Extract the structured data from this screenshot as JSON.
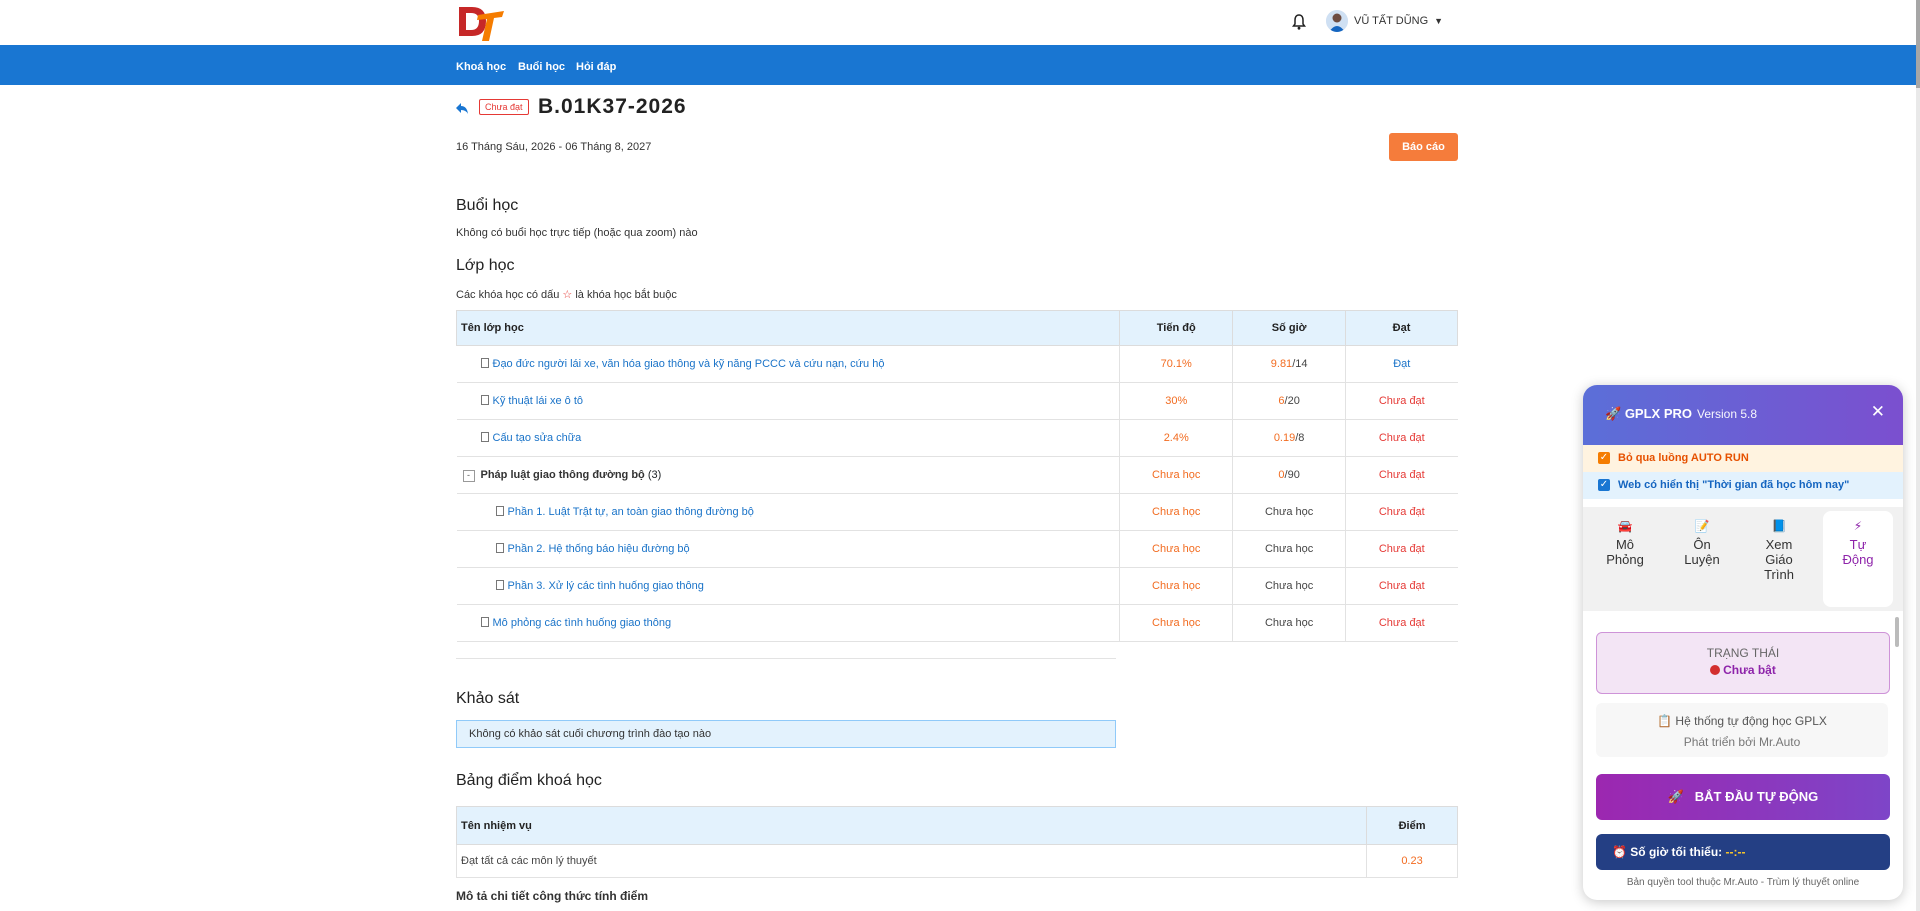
{
  "header": {
    "user_name": "VŨ TẤT DŨNG",
    "nav": [
      "Khoá học",
      "Buổi học",
      "Hỏi đáp"
    ]
  },
  "course": {
    "status_badge": "Chưa đạt",
    "code": "B.01K37-2026",
    "date_range": "16 Tháng Sáu, 2026 - 06 Tháng 8, 2027",
    "report_button": "Báo cáo"
  },
  "sessions": {
    "title": "Buổi học",
    "text": "Không có buổi học trực tiếp (hoặc qua zoom) nào"
  },
  "classes": {
    "title": "Lớp học",
    "note_before": "Các khóa học có dấu",
    "note_after": "là khóa học bắt buộc",
    "headers": [
      "Tên lớp học",
      "Tiến độ",
      "Số giờ",
      "Đạt"
    ],
    "rows": [
      {
        "name": "Đạo đức người lái xe, văn hóa giao thông và kỹ năng PCCC và cứu nạn, cứu hộ",
        "progress": "70.1%",
        "hours_done": "9.81",
        "hours_total": "/14",
        "status": "Đạt"
      },
      {
        "name": "Kỹ thuật lái xe ô tô",
        "progress": "30%",
        "hours_done": "6",
        "hours_total": "/20",
        "status": "Chưa đạt"
      },
      {
        "name": "Cấu tạo sửa chữa",
        "progress": "2.4%",
        "hours_done": "0.19",
        "hours_total": "/8",
        "status": "Chưa đạt"
      },
      {
        "name": "Pháp luật giao thông đường bộ",
        "count": "(3)",
        "progress": "Chưa học",
        "hours_done": "0",
        "hours_total": "/90",
        "status": "Chưa đạt"
      },
      {
        "name": "Phần 1. Luật Trật tự, an toàn giao thông đường bộ",
        "progress": "Chưa học",
        "hours": "Chưa học",
        "status": "Chưa đạt"
      },
      {
        "name": "Phần 2. Hệ thống báo hiệu đường bộ",
        "progress": "Chưa học",
        "hours": "Chưa học",
        "status": "Chưa đạt"
      },
      {
        "name": "Phần 3. Xử lý các tình huống giao thông",
        "progress": "Chưa học",
        "hours": "Chưa học",
        "status": "Chưa đạt"
      },
      {
        "name": "Mô phỏng các tình huống giao thông",
        "progress": "Chưa học",
        "hours": "Chưa học",
        "status": "Chưa đạt"
      }
    ]
  },
  "survey": {
    "title": "Khảo sát",
    "text": "Không có khảo sát cuối chương trình đào tạo nào"
  },
  "scores": {
    "title": "Bảng điểm khoá học",
    "headers": [
      "Tên nhiệm vụ",
      "Điểm"
    ],
    "row_task": "Đạt tất cả các môn lý thuyết",
    "row_score": "0.23",
    "footer": "Mô tả chi tiết công thức tính điểm"
  },
  "panel": {
    "title": "GPLX PRO",
    "version": "Version 5.8",
    "option1": "Bỏ qua luồng AUTO RUN",
    "option2": "Web có hiển thị \"Thời gian đã học hôm nay\"",
    "tabs": [
      {
        "line1": "Mô",
        "line2": "Phỏng"
      },
      {
        "line1": "Ôn",
        "line2": "Luyện"
      },
      {
        "line1": "Xem",
        "line2": "Giáo",
        "line3": "Trình"
      },
      {
        "line1": "Tự",
        "line2": "Động"
      }
    ],
    "state_label": "TRẠNG THÁI",
    "state_value": "Chưa bật",
    "system_line1": "Hệ thống tự động học GPLX",
    "system_line2": "Phát triển bởi Mr.Auto",
    "start_button": "BẮT ĐẦU TỰ ĐỘNG",
    "min_hours_label": "Số giờ tối thiểu:",
    "min_hours_value": "--:--",
    "copyright": "Bản quyền tool thuộc Mr.Auto - Trùm lý thuyết online"
  },
  "colors": {
    "nav_blue": "#1976d2",
    "accent_orange": "#f26c21",
    "status_red": "#e53935",
    "panel_purple": "#8e24aa"
  }
}
